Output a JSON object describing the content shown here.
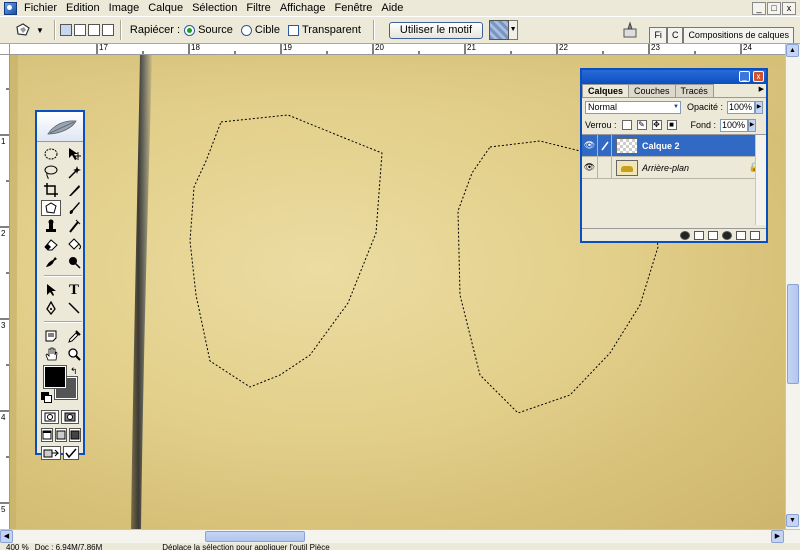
{
  "menubar": {
    "items": [
      "Fichier",
      "Edition",
      "Image",
      "Calque",
      "Sélection",
      "Filtre",
      "Affichage",
      "Fenêtre",
      "Aide"
    ],
    "window_buttons": [
      "_",
      "□",
      "x"
    ]
  },
  "options": {
    "patch_label": "Rapiécer :",
    "source_label": "Source",
    "target_label": "Cible",
    "transparent_label": "Transparent",
    "use_pattern_label": "Utiliser le motif",
    "source_selected": true,
    "transparent_checked": false,
    "palette_tabs": [
      "Fi",
      "C",
      "Compositions de calques"
    ]
  },
  "ruler": {
    "h_labels": [
      "17",
      "18",
      "19",
      "20",
      "21",
      "22",
      "23",
      "24"
    ],
    "v_labels": [
      "1",
      "2",
      "3",
      "4",
      "5"
    ]
  },
  "layers_panel": {
    "tabs": [
      "Calques",
      "Couches",
      "Tracés"
    ],
    "active_tab": "Calques",
    "blend_mode": "Normal",
    "opacity_label": "Opacité :",
    "opacity_value": "100%",
    "lock_label": "Verrou :",
    "fill_label": "Fond :",
    "fill_value": "100%",
    "layers": [
      {
        "name": "Calque 2",
        "active": true,
        "visible": true,
        "locked": false
      },
      {
        "name": "Arrière-plan",
        "active": false,
        "visible": true,
        "locked": true
      }
    ]
  },
  "status": {
    "zoom": "400 %",
    "doc": "Doc : 6,94M/7,86M",
    "hint": "Déplace la sélection pour appliquer l'outil Pièce"
  },
  "colors": {
    "foreground": "#000000",
    "background": "#555555",
    "accent": "#0a4fbf",
    "selection": "#316ac5"
  }
}
